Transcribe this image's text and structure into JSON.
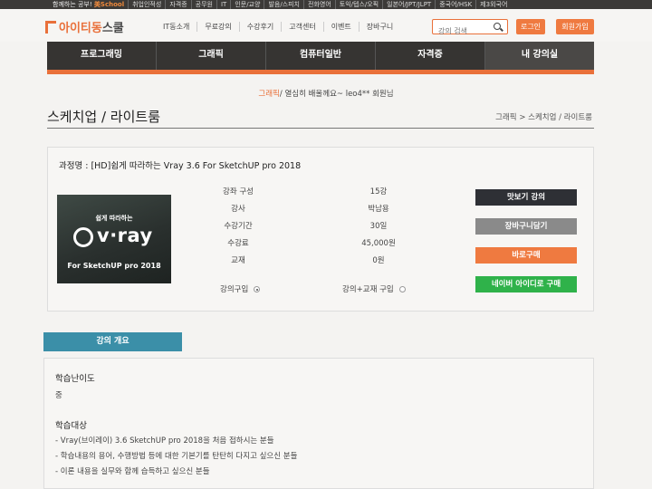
{
  "top_strip": {
    "slogan_prefix": "함께하는 공부!",
    "brand": "美School",
    "categories": [
      "취업인적성",
      "자격증",
      "공무원",
      "IT",
      "인문/교양",
      "발음/스피치",
      "전화영어",
      "토익/텝스/오픽",
      "일본어/JPT/JLPT",
      "중국어/HSK",
      "제3외국어"
    ]
  },
  "header": {
    "logo_main": "아이티동",
    "logo_suffix": "스쿨",
    "nav": [
      "IT동소개",
      "무료강의",
      "수강후기",
      "고객센터",
      "이벤트",
      "장바구니"
    ],
    "search_placeholder": "강의 검색",
    "login": "로그인",
    "signup": "회원가입"
  },
  "main_nav": [
    "프로그래밍",
    "그래픽",
    "컴퓨터일반",
    "자격증",
    "내 강의실"
  ],
  "greeting": {
    "highlight": "그래픽",
    "rest": "/ 열심히 배울께요~ leo4** 회원님"
  },
  "page_title": "스케치업 / 라이트룸",
  "breadcrumb": "그래픽 > 스케치업 / 라이트룸",
  "course": {
    "name": "과정명 : [HD]쉽게 따라하는 Vray 3.6 For SketchUP pro 2018",
    "thumb_sub": "쉽게 따라하는",
    "thumb_logo": "v·ray",
    "thumb_for": "For SketchUP pro 2018",
    "rows": [
      {
        "label": "강좌 구성",
        "value": "15강"
      },
      {
        "label": "강사",
        "value": "박남용"
      },
      {
        "label": "수강기간",
        "value": "30일"
      },
      {
        "label": "수강료",
        "value": "45,000원"
      },
      {
        "label": "교재",
        "value": "0원"
      }
    ],
    "option_lecture": "강의구입",
    "option_lecture_book": "강의+교재 구입",
    "buttons": {
      "preview": "맛보기 강의",
      "cart": "장바구니담기",
      "buy": "바로구매",
      "naver": "네이버 아이디로 구매"
    }
  },
  "tab_overview": "강의 개요",
  "description": {
    "difficulty_heading": "학습난이도",
    "difficulty_value": "중",
    "target_heading": "학습대상",
    "target_items": [
      "- Vray(브이레이) 3.6 SketchUP pro 2018을 처음 접하시는 분들",
      "- 학습내용의 용어, 수행방법 등에 대한 기본기를 탄탄히 다지고 싶으신 분들",
      "- 이론 내용을 실무와 함께 습득하고 싶으신 분들"
    ]
  },
  "colors": {
    "accent_orange": "#e9703a",
    "nav_dark": "#363432",
    "btn_preview": "#2e3035",
    "btn_cart": "#8a8a8a",
    "btn_buy": "#ef7a40",
    "btn_naver": "#2fb24a",
    "tab_blue": "#3b8fa8"
  }
}
